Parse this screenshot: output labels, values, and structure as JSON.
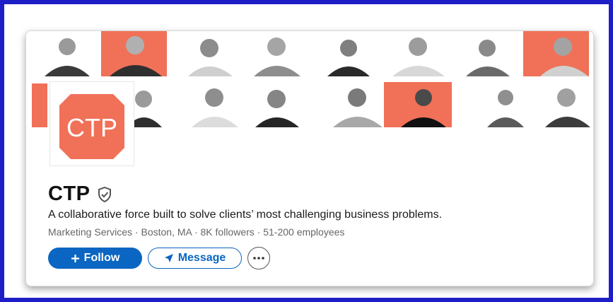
{
  "company": {
    "name": "CTP",
    "logo_text": "CTP",
    "tagline": "A collaborative force built to solve clients’ most challenging business problems.",
    "meta": "Marketing Services · Boston, MA · 8K followers · 51-200 employees"
  },
  "actions": {
    "follow_label": "Follow",
    "follow_icon": "plus-icon",
    "message_label": "Message",
    "message_icon": "paper-plane-icon",
    "more_icon": "ellipsis-icon"
  },
  "colors": {
    "frame_border": "#1e1ec8",
    "brand_orange": "#f07158",
    "linkedin_blue": "#0a66c2"
  }
}
